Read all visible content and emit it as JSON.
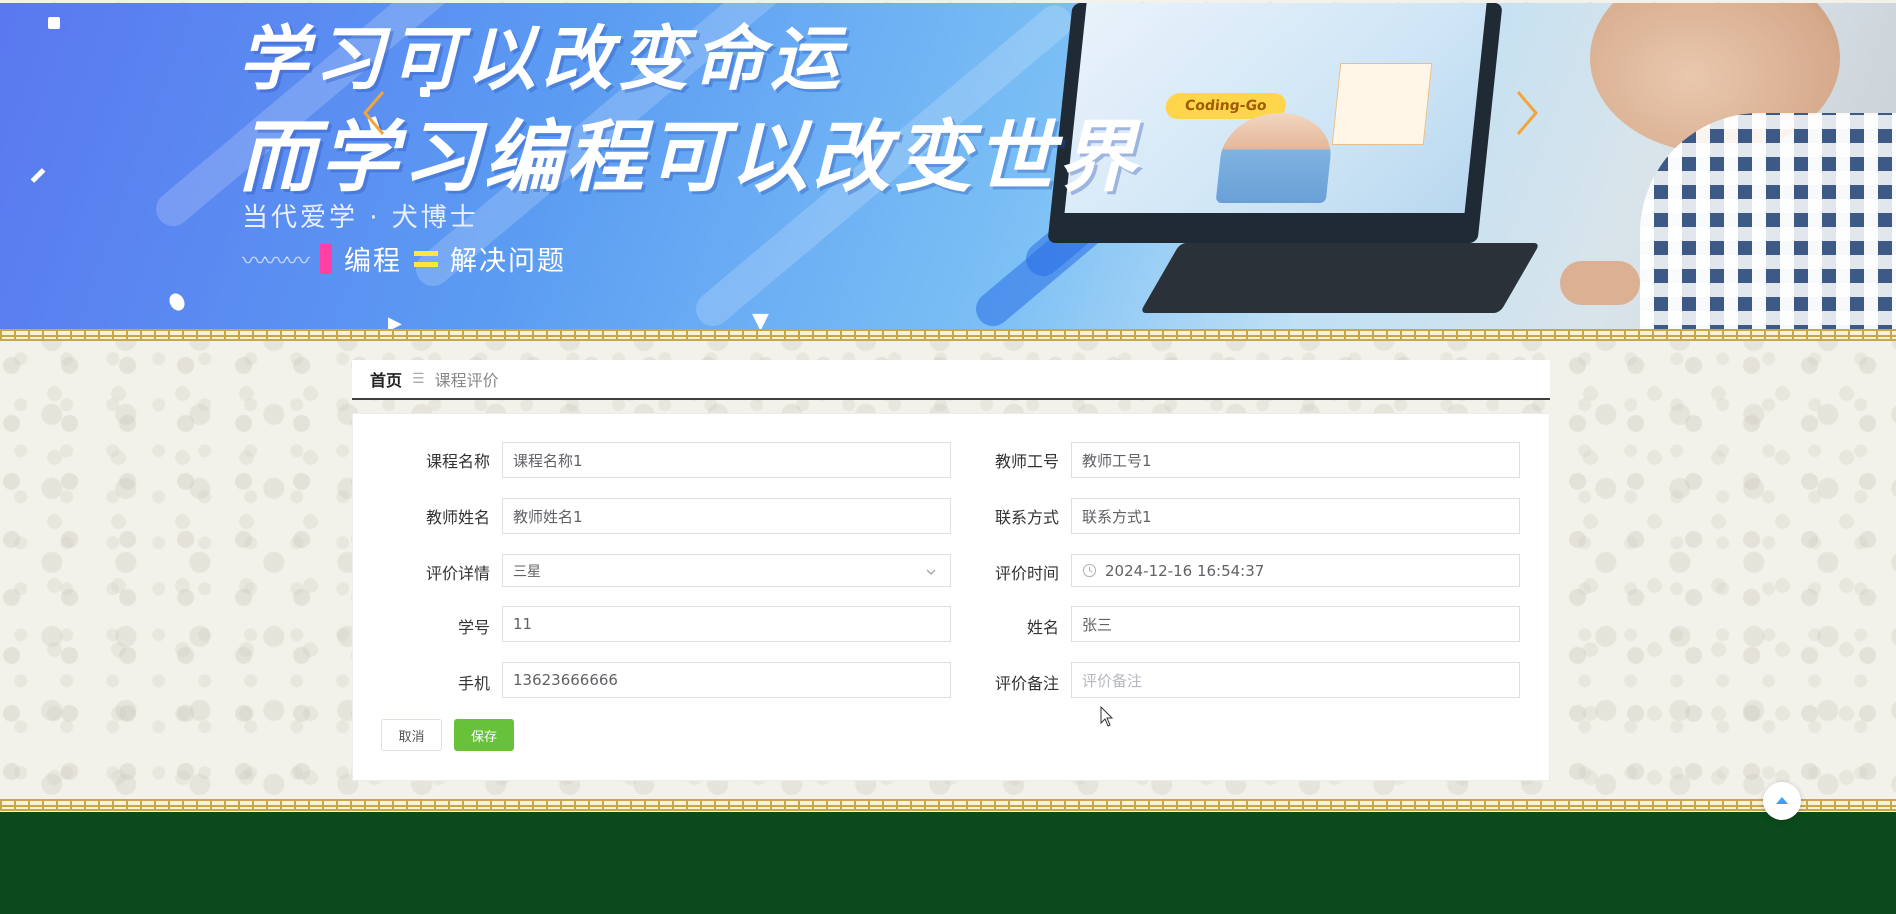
{
  "banner": {
    "headline_line1": "学习可以改变命运",
    "headline_line2": "而学习编程可以改变世界",
    "subtitle": "当代爱学 · 犬博士",
    "slogan_left": "编程",
    "slogan_right": "解决问题",
    "screen_pill": "Coding-Go"
  },
  "breadcrumb": {
    "home": "首页",
    "separator": "☰",
    "current": "课程评价"
  },
  "form": {
    "course_name": {
      "label": "课程名称",
      "value": "课程名称1"
    },
    "teacher_id": {
      "label": "教师工号",
      "value": "教师工号1"
    },
    "teacher_name": {
      "label": "教师姓名",
      "value": "教师姓名1"
    },
    "contact": {
      "label": "联系方式",
      "value": "联系方式1"
    },
    "rating": {
      "label": "评价详情",
      "value": "三星"
    },
    "eval_time": {
      "label": "评价时间",
      "value": "2024-12-16 16:54:37"
    },
    "student_id": {
      "label": "学号",
      "value": "11"
    },
    "student_name": {
      "label": "姓名",
      "value": "张三"
    },
    "phone": {
      "label": "手机",
      "value": "13623666666"
    },
    "remark": {
      "label": "评价备注",
      "placeholder": "评价备注"
    }
  },
  "buttons": {
    "cancel": "取消",
    "save": "保存"
  },
  "colors": {
    "save_green": "#67c23a",
    "footer_green": "#0b4a1a",
    "arrow_orange": "#f3a43a"
  }
}
